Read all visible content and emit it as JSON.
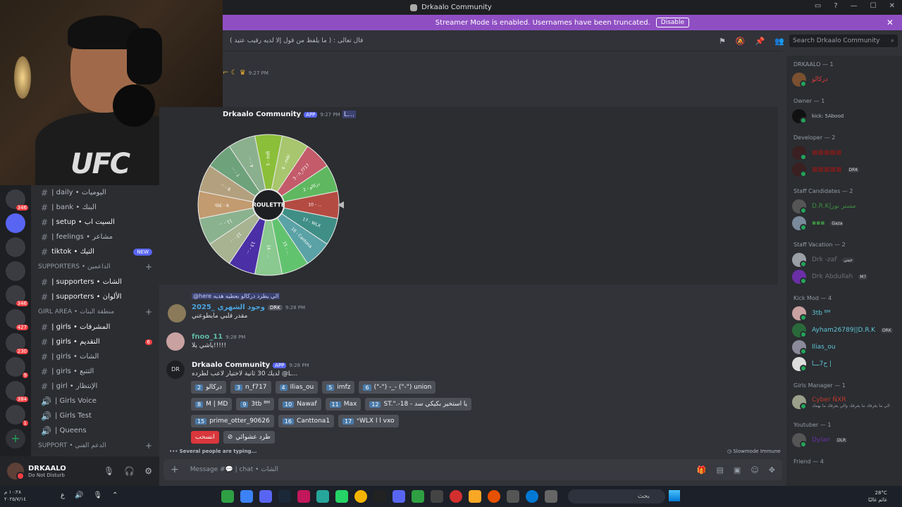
{
  "window": {
    "title": "Drkaalo Community"
  },
  "streamer_bar": {
    "text": "Streamer Mode is enabled. Usernames have been truncated.",
    "disable_label": "Disable"
  },
  "channel_header": {
    "topic": "( قال تعالى : ( ما يلفظ من قول إلا لديه رقيب عتيد"
  },
  "search": {
    "placeholder": "Search Drkaalo Community"
  },
  "channels": {
    "daily_label": "| daily • اليوميات",
    "bank_label": "| bank • البنك",
    "setup_label": "| setup • السيت اب",
    "feelings_label": "| feelings • مشاعر",
    "tiktok_label": "tiktok • التيك",
    "new_badge": "NEW",
    "supporters_cat": "Supporters • الداعمين",
    "supporters1_label": "| supporters • الشات",
    "supporters2_label": "| supporters • الألوان",
    "girl_area_cat": "GIRL AREA • منطقة البنات",
    "girls1_label": "| girls • المشرفات",
    "girls2_label": "| girls • التقديم",
    "girls2_count": "6",
    "girls3_label": "| girls • الشات",
    "girls4_label": "| girls • التتبع",
    "girl5_label": "| girl • الإنتظار",
    "girls_voice_label": "| Girls Voice",
    "girls_test_label": "| Girls Test",
    "queens_label": "| Queens",
    "support_cat": "SUPPORT • الدعم الفني"
  },
  "server_badges": [
    "346",
    "427",
    "230",
    "9",
    "384",
    "1"
  ],
  "user_panel": {
    "name": "DRKAALO",
    "status": "Do Not Disturb"
  },
  "messages": {
    "top_time": "9:27 PM",
    "bot_name": "Drkaalo Community",
    "app_tag": "APP",
    "bot_time1": "9:27 PM",
    "bot_mention": "L...",
    "wheel_center": "ROULETTE",
    "reply_preview": "@here الي يطرد دركالو بعطيه هديه",
    "m1_author": "وجود الشهري _2025",
    "m1_role": "DRK",
    "m1_time": "9:28 PM",
    "m1_text": "مقدر قلبي مايطوعني",
    "m2_author": "fnoo_11",
    "m2_time": "9:28 PM",
    "m2_text": "ياشي يلا!!!!!",
    "m3_author": "Drkaalo Community",
    "m3_time": "9:28 PM",
    "m3_text": "لديك 30 ثانية لاختيار لاعب لطرده @L...",
    "withdraw_label": "انسحب",
    "random_kick_label": "طرد عشوائي"
  },
  "wheel_segments": [
    {
      "label": "5 - inifi",
      "color": "#8bbf3a"
    },
    {
      "label": "6 - miki",
      "color": "#a7c66d"
    },
    {
      "label": "3 - n_f717",
      "color": "#c35b6a"
    },
    {
      "label": "2 - دركالو",
      "color": "#5fb85f"
    },
    {
      "label": "10 - ...",
      "color": "#b44b42"
    },
    {
      "label": "17 - WLX",
      "color": "#3f8f86"
    },
    {
      "label": "16 - Cantona",
      "color": "#5aa2a6"
    },
    {
      "label": "15 - ...",
      "color": "#62c36e"
    },
    {
      "label": "14 - ...",
      "color": "#8ac98f"
    },
    {
      "label": "13 - ...",
      "color": "#4a2fa6"
    },
    {
      "label": "12 - ...",
      "color": "#a7b391"
    },
    {
      "label": "11 - ...",
      "color": "#8bb28e"
    },
    {
      "label": "9 - 3tb",
      "color": "#c29b70"
    },
    {
      "label": "8 - ...",
      "color": "#b3a07e"
    },
    {
      "label": "7 - ...",
      "color": "#6ea27a"
    },
    {
      "label": "4 - ...",
      "color": "#8bb08e"
    }
  ],
  "pick_buttons": [
    [
      {
        "n": "2",
        "name": "دركالو"
      },
      {
        "n": "3",
        "name": "n_f717"
      },
      {
        "n": "4",
        "name": "Ilias_ou"
      },
      {
        "n": "5",
        "name": "imfz"
      },
      {
        "n": "6",
        "name": "(\"-\") -_- (\"-\") union"
      }
    ],
    [
      {
        "n": "8",
        "name": "M | MD"
      },
      {
        "n": "9",
        "name": "3tb ᴮᴹ"
      },
      {
        "n": "10",
        "name": "Nawaf"
      },
      {
        "n": "11",
        "name": "Max"
      },
      {
        "n": "12",
        "name": "ST.\".-18 - يا استخير بكيكي سد"
      }
    ],
    [
      {
        "n": "15",
        "name": "prime_otter_90626"
      },
      {
        "n": "16",
        "name": "Canttona1"
      },
      {
        "n": "17",
        "name": "ᵛWLX ا ا vxo"
      }
    ]
  ],
  "typing": {
    "text": "Several people are typing..."
  },
  "slowmode": {
    "text": "Slowmode Immune"
  },
  "composer": {
    "placeholder": "Message #💬 | chat • الشات"
  },
  "members": {
    "cat_drkaalo": "DRKAALO — 1",
    "m_drkaalo": "دركالو",
    "cat_owner": "Owner — 1",
    "m_owner": "kick: 5Abood",
    "cat_dev": "Developer — 2",
    "m_dev_tag": "DRK",
    "cat_staffcand": "Staff Candidates — 2",
    "m_sc1": "D.R.K|مستر نور",
    "m_sc2": "Gaza",
    "cat_vacation": "Staff Vacation — 2",
    "m_v1": "Drk -zaf",
    "m_v1_tag": "جيني",
    "m_v2": "Drk Abdullah",
    "m_v2_tag": "M7",
    "cat_kickmod": "Kick Mod — 4",
    "m_k1": "3tb ᴮᴹ",
    "m_k2": "Ayham26789||D.R.K",
    "m_k2_tag": "DRK",
    "m_k3": "Ilias_ou",
    "m_k4": "ح7ـــا |",
    "cat_girlsmgr": "Girls Manager — 1",
    "m_g1": "Cyber ŇXR",
    "m_g1_sub": "الي ما يعرفك ما يعرفك والي يعرفك ما يهمك",
    "cat_youtuber": "Youtuber — 1",
    "m_y1": "Dylan",
    "m_y1_tag": "DLR",
    "cat_friend": "Friend — 4"
  },
  "taskbar": {
    "time": "١٠:٢٨ م",
    "date": "٢٠٢٥/٧/١٤",
    "lang": "ع",
    "search_placeholder": "بحث",
    "temp": "28°C",
    "weather": "غائم غالبًا"
  },
  "colors": {
    "accent": "#5865f2",
    "danger": "#da373c",
    "streamer": "#8f4fc3"
  }
}
